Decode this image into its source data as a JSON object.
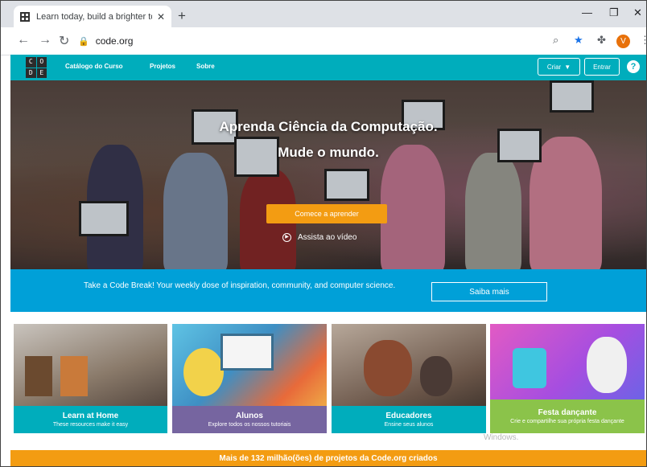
{
  "browser": {
    "tab_title": "Learn today, build a brighter tom",
    "url": "code.org"
  },
  "site": {
    "logo": [
      "C",
      "O",
      "D",
      "E"
    ],
    "nav": [
      "Catálogo do Curso",
      "Projetos",
      "Sobre"
    ],
    "create_label": "Criar",
    "signin_label": "Entrar",
    "help_label": "?"
  },
  "hero": {
    "title_line1": "Aprenda Ciência da Computação.",
    "title_line2": "Mude o mundo.",
    "cta_label": "Comece a aprender",
    "watch_label": "Assista ao vídeo"
  },
  "banner": {
    "text": "Take a Code Break! Your weekly dose of inspiration, community, and computer science.",
    "button_label": "Saiba mais"
  },
  "cards": [
    {
      "title": "Learn at Home",
      "subtitle": "These resources make it easy",
      "color": "#00adbc"
    },
    {
      "title": "Alunos",
      "subtitle": "Explore todos os nossos tutoriais",
      "color": "#7665a0"
    },
    {
      "title": "Educadores",
      "subtitle": "Ensine seus alunos",
      "color": "#00adbc"
    },
    {
      "title": "Festa dançante",
      "subtitle": "Crie e compartilhe sua própria festa dançante",
      "color": "#8bc34a"
    }
  ],
  "watermark": "Windows.",
  "stats": "Mais de 132 milhão(ões) de projetos da Code.org criados",
  "colors": {
    "teal": "#00adbc",
    "blue": "#00a0d8",
    "orange": "#f39c12",
    "purple": "#7665a0",
    "green": "#8bc34a"
  }
}
